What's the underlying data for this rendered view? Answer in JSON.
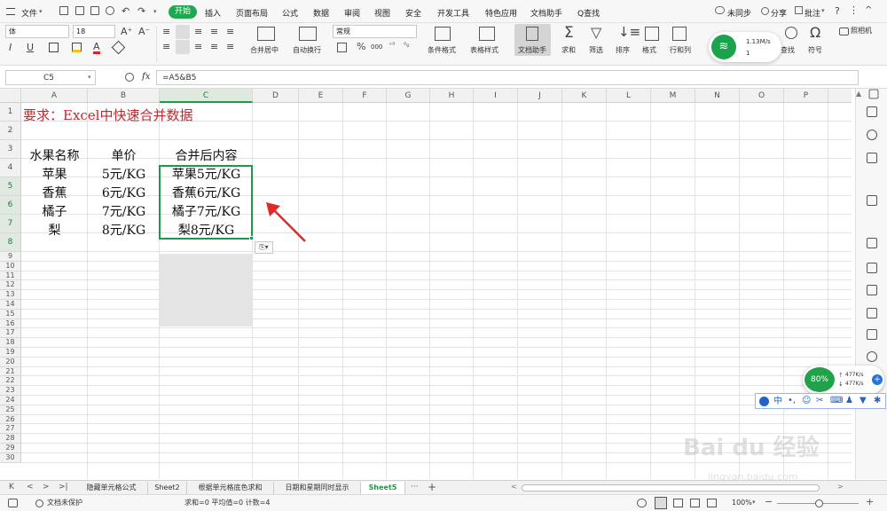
{
  "menu": {
    "file": "文件",
    "items": [
      "开始",
      "插入",
      "页面布局",
      "公式",
      "数据",
      "审阅",
      "视图",
      "安全",
      "开发工具",
      "特色应用",
      "文档助手"
    ],
    "search": "Q查找",
    "right": [
      "未同步",
      "分享",
      "批注"
    ]
  },
  "ribbon": {
    "font_name": "体",
    "font_size": "18",
    "number_format": "常规",
    "labels": {
      "merge": "合并居中",
      "wrap": "自动换行",
      "cond_format": "条件格式",
      "table_style": "表格样式",
      "doc_helper": "文档助手",
      "sum": "求和",
      "filter": "筛选",
      "sort": "排序",
      "format": "格式",
      "rowcol": "行和列",
      "find": "查找",
      "symbol": "符号",
      "camera": "照相机"
    },
    "percent": "%",
    "thousands": "000"
  },
  "net_widget": {
    "speed": "1.13M/s",
    "count": "1"
  },
  "formula_bar": {
    "cell_ref": "C5",
    "fx": "fx",
    "formula": "=A5&B5"
  },
  "columns": [
    "A",
    "B",
    "C",
    "D",
    "E",
    "F",
    "G",
    "H",
    "I",
    "J",
    "K",
    "L",
    "M",
    "N",
    "O",
    "P"
  ],
  "rows": [
    "1",
    "2",
    "3",
    "4",
    "5",
    "6",
    "7",
    "8",
    "9",
    "10",
    "11",
    "12",
    "13",
    "14",
    "15",
    "16",
    "17",
    "18",
    "19",
    "20",
    "21",
    "22",
    "23",
    "24",
    "25",
    "26",
    "27",
    "28",
    "29",
    "30"
  ],
  "sheet": {
    "title": "要求：Excel中快速合并数据",
    "headers": [
      "水果名称",
      "单价",
      "合并后内容"
    ],
    "data": [
      [
        "苹果",
        "5元/KG",
        "苹果5元/KG"
      ],
      [
        "香蕉",
        "6元/KG",
        "香蕉6元/KG"
      ],
      [
        "橘子",
        "7元/KG",
        "橘子7元/KG"
      ],
      [
        "梨",
        "8元/KG",
        "梨8元/KG"
      ]
    ]
  },
  "speed_widget": {
    "percent": "80%",
    "up": "477K/s",
    "down": "477K/s"
  },
  "ime_bar": {
    "mode": "中"
  },
  "tabs": [
    "隐藏单元格公式",
    "Sheet2",
    "根据单元格底色求和",
    "日期和星期同时显示",
    "Sheet5"
  ],
  "tabs_more": "···",
  "tabs_add": "+",
  "status": {
    "protect": "文档未保护",
    "stats": "求和=0  平均值=0  计数=4",
    "zoom": "100%"
  },
  "watermark": {
    "brand": "Bai du 经验",
    "url": "jingyan.baidu.com"
  }
}
